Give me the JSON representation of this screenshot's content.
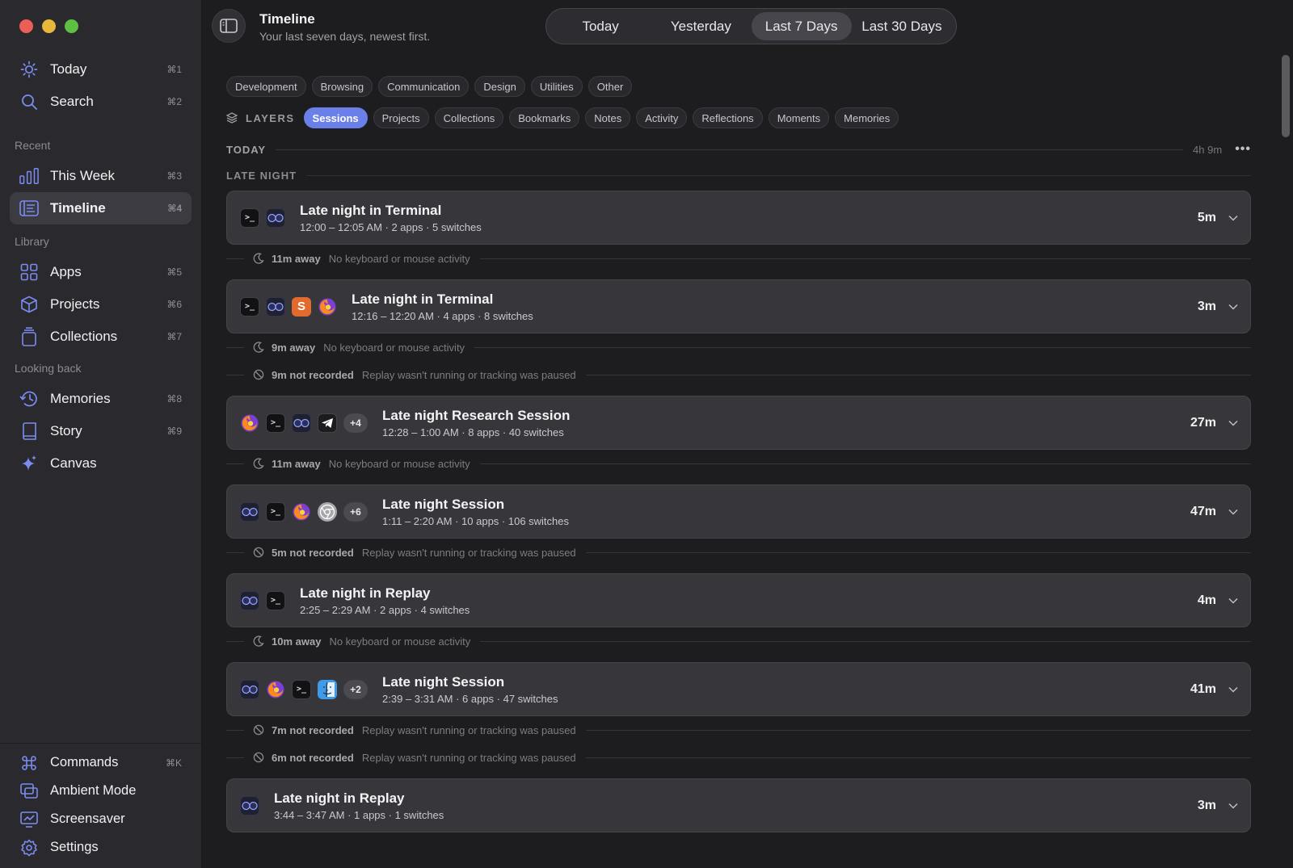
{
  "window": {
    "title": "Timeline",
    "subtitle": "Your last seven days, newest first."
  },
  "sidebar": {
    "top": [
      {
        "label": "Today",
        "kbd": "⌘1",
        "icon": "sun-icon"
      },
      {
        "label": "Search",
        "kbd": "⌘2",
        "icon": "search-icon"
      }
    ],
    "recent_label": "Recent",
    "recent": [
      {
        "label": "This Week",
        "kbd": "⌘3",
        "icon": "bar-chart-icon"
      },
      {
        "label": "Timeline",
        "kbd": "⌘4",
        "icon": "timeline-icon",
        "active": true
      }
    ],
    "library_label": "Library",
    "library": [
      {
        "label": "Apps",
        "kbd": "⌘5",
        "icon": "grid-icon"
      },
      {
        "label": "Projects",
        "kbd": "⌘6",
        "icon": "box-icon"
      },
      {
        "label": "Collections",
        "kbd": "⌘7",
        "icon": "stack-icon"
      }
    ],
    "lookback_label": "Looking back",
    "lookback": [
      {
        "label": "Memories",
        "kbd": "⌘8",
        "icon": "history-icon"
      },
      {
        "label": "Story",
        "kbd": "⌘9",
        "icon": "book-icon"
      },
      {
        "label": "Canvas",
        "kbd": "",
        "icon": "sparkle-icon"
      }
    ],
    "footer": [
      {
        "label": "Commands",
        "kbd": "⌘K",
        "icon": "command-icon"
      },
      {
        "label": "Ambient Mode",
        "kbd": "",
        "icon": "ambient-icon"
      },
      {
        "label": "Screensaver",
        "kbd": "",
        "icon": "screensaver-icon"
      },
      {
        "label": "Settings",
        "kbd": "",
        "icon": "gear-icon"
      }
    ]
  },
  "range_tabs": [
    {
      "label": "Today"
    },
    {
      "label": "Yesterday"
    },
    {
      "label": "Last 7 Days",
      "active": true
    },
    {
      "label": "Last 30 Days"
    }
  ],
  "categories": [
    "Development",
    "Browsing",
    "Communication",
    "Design",
    "Utilities",
    "Other"
  ],
  "layers": {
    "label": "LAYERS",
    "items": [
      "Sessions",
      "Projects",
      "Collections",
      "Bookmarks",
      "Notes",
      "Activity",
      "Reflections",
      "Moments",
      "Memories"
    ],
    "active": "Sessions"
  },
  "day": {
    "label": "TODAY",
    "total": "4h 9m"
  },
  "period": "LATE NIGHT",
  "colors": {
    "accent": "#6a7fe8"
  },
  "rows": [
    {
      "kind": "session",
      "title": "Late night in Terminal",
      "meta": "12:00 – 12:05 AM · 2 apps · 5 switches",
      "duration": "5m",
      "apps": [
        "terminal",
        "replay"
      ]
    },
    {
      "kind": "away",
      "amount": "11m away",
      "desc": "No keyboard or mouse activity"
    },
    {
      "kind": "session",
      "title": "Late night in Terminal",
      "meta": "12:16 – 12:20 AM · 4 apps · 8 switches",
      "duration": "3m",
      "apps": [
        "terminal",
        "replay",
        "sublime",
        "firefox"
      ]
    },
    {
      "kind": "away",
      "amount": "9m away",
      "desc": "No keyboard or mouse activity"
    },
    {
      "kind": "notrec",
      "amount": "9m not recorded",
      "desc": "Replay wasn't running or tracking was paused"
    },
    {
      "kind": "session",
      "title": "Late night Research Session",
      "meta": "12:28 – 1:00 AM · 8 apps · 40 switches",
      "duration": "27m",
      "apps": [
        "firefox",
        "terminal",
        "replay",
        "telegram"
      ],
      "more": "+4"
    },
    {
      "kind": "away",
      "amount": "11m away",
      "desc": "No keyboard or mouse activity"
    },
    {
      "kind": "session",
      "title": "Late night Session",
      "meta": "1:11 – 2:20 AM · 10 apps · 106 switches",
      "duration": "47m",
      "apps": [
        "replay",
        "terminal",
        "firefox",
        "chrome"
      ],
      "more": "+6"
    },
    {
      "kind": "notrec",
      "amount": "5m not recorded",
      "desc": "Replay wasn't running or tracking was paused"
    },
    {
      "kind": "session",
      "title": "Late night in Replay",
      "meta": "2:25 – 2:29 AM · 2 apps · 4 switches",
      "duration": "4m",
      "apps": [
        "replay",
        "terminal"
      ]
    },
    {
      "kind": "away",
      "amount": "10m away",
      "desc": "No keyboard or mouse activity"
    },
    {
      "kind": "session",
      "title": "Late night Session",
      "meta": "2:39 – 3:31 AM · 6 apps · 47 switches",
      "duration": "41m",
      "apps": [
        "replay",
        "firefox",
        "terminal",
        "finder"
      ],
      "more": "+2"
    },
    {
      "kind": "notrec",
      "amount": "7m not recorded",
      "desc": "Replay wasn't running or tracking was paused"
    },
    {
      "kind": "notrec",
      "amount": "6m not recorded",
      "desc": "Replay wasn't running or tracking was paused"
    },
    {
      "kind": "session",
      "title": "Late night in Replay",
      "meta": "3:44 – 3:47 AM · 1 apps · 1 switches",
      "duration": "3m",
      "apps": [
        "replay"
      ]
    }
  ]
}
